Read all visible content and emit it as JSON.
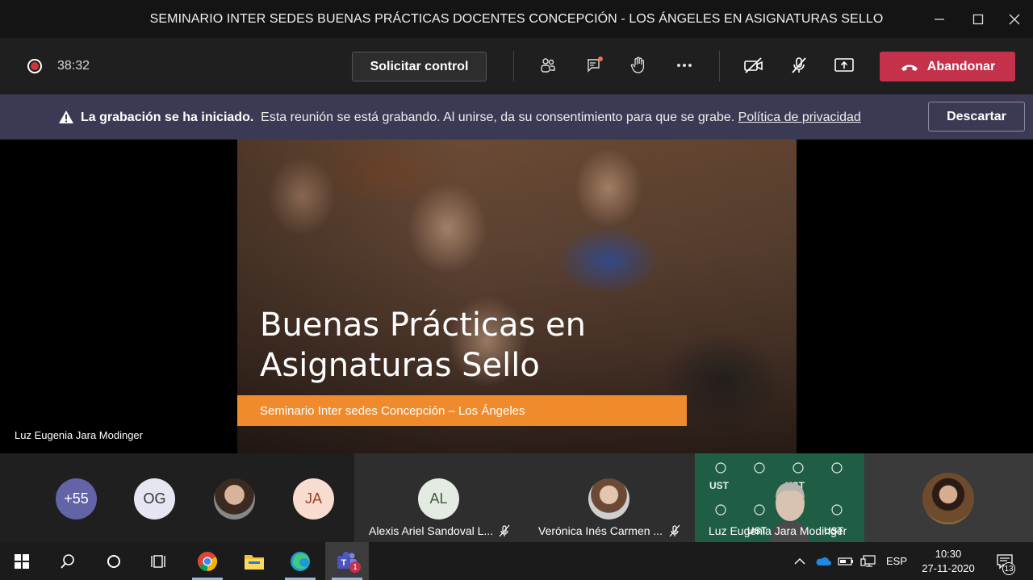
{
  "window": {
    "title": "SEMINARIO INTER SEDES BUENAS PRÁCTICAS DOCENTES CONCEPCIÓN - LOS ÁNGELES EN ASIGNATURAS SELLO"
  },
  "toolbar": {
    "timer": "38:32",
    "request_control_label": "Solicitar control",
    "leave_label": "Abandonar"
  },
  "banner": {
    "bold_text": "La grabación se ha iniciado.",
    "text": "Esta reunión se está grabando. Al unirse, da su consentimiento para que se grabe.",
    "link_text": "Política de privacidad",
    "dismiss_label": "Descartar"
  },
  "slide": {
    "title_line1": "Buenas Prácticas en",
    "title_line2": "Asignaturas Sello",
    "subtitle": "Seminario Inter sedes Concepción – Los Ángeles"
  },
  "presenter_name": "Luz Eugenia Jara Modinger",
  "participants": {
    "overflow_count": "+55",
    "initials_og": "OG",
    "initials_ja": "JA",
    "tile1": {
      "initials": "AL",
      "name": "Alexis Ariel Sandoval L..."
    },
    "tile2": {
      "name": "Verónica Inés Carmen ..."
    },
    "tile3": {
      "name": "Luz Eugenia Jara Modinger"
    }
  },
  "taskbar": {
    "language": "ESP",
    "time": "10:30",
    "date": "27-11-2020",
    "notification_count": "13",
    "teams_badge": "1"
  },
  "colors": {
    "accent_red": "#c4314b",
    "banner_bg": "#3b3a55",
    "slide_orange": "#ef8b2c"
  }
}
